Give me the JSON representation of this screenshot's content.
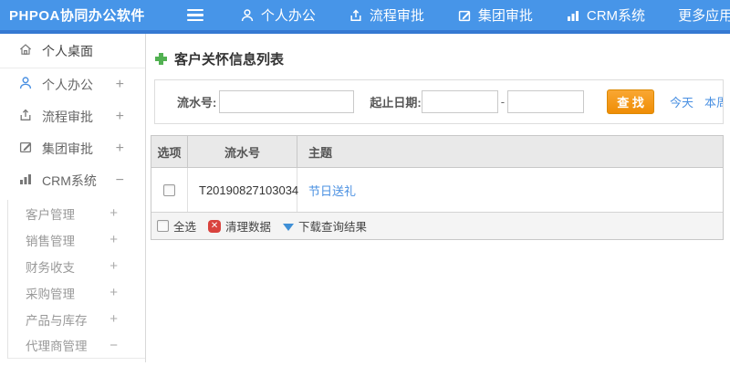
{
  "app": {
    "logo": "PHPOA协同办公软件"
  },
  "header": {
    "nav": [
      {
        "label": "个人办公",
        "icon": "user-icon"
      },
      {
        "label": "流程审批",
        "icon": "flow-approval-icon"
      },
      {
        "label": "集团审批",
        "icon": "edit-icon"
      },
      {
        "label": "CRM系统",
        "icon": "bar-chart-icon"
      },
      {
        "label": "更多应用",
        "icon": "caret-down-icon"
      }
    ]
  },
  "sidebar": {
    "desktop": {
      "label": "个人桌面",
      "icon": "home-icon"
    },
    "items": [
      {
        "label": "个人办公",
        "icon": "user-icon",
        "expand": "+"
      },
      {
        "label": "流程审批",
        "icon": "flow-approval-icon",
        "expand": "+"
      },
      {
        "label": "集团审批",
        "icon": "edit-icon",
        "expand": "+"
      },
      {
        "label": "CRM系统",
        "icon": "bar-chart-icon",
        "expand": "−"
      }
    ],
    "submenu": [
      {
        "label": "客户管理",
        "expand": "+"
      },
      {
        "label": "销售管理",
        "expand": "+"
      },
      {
        "label": "财务收支",
        "expand": "+"
      },
      {
        "label": "采购管理",
        "expand": "+"
      },
      {
        "label": "产品与库存",
        "expand": "+"
      },
      {
        "label": "代理商管理",
        "expand": "−"
      }
    ]
  },
  "main": {
    "title": "客户关怀信息列表",
    "filter": {
      "serial_label": "流水号:",
      "date_label": "起止日期:",
      "range_separator": "-",
      "search_button": "查 找",
      "quick_links": [
        "今天",
        "本周"
      ]
    },
    "table": {
      "headers": [
        "选项",
        "流水号",
        "主题"
      ],
      "rows": [
        {
          "serial": "T20190827103034",
          "subject": "节日送礼"
        }
      ]
    },
    "list_footer": {
      "select_all": "全选",
      "clear_data": "清理数据",
      "download": "下载查询结果",
      "clear_glyph": "✕"
    }
  },
  "colors": {
    "header_blue": "#4795e8",
    "header_blue_dark": "#3579d2",
    "accent_blue": "#4a90e2",
    "button_orange": "#ef8d05",
    "plus_green": "#52b152",
    "clear_red": "#d9433e",
    "table_header_bg": "#e9e9e9"
  }
}
